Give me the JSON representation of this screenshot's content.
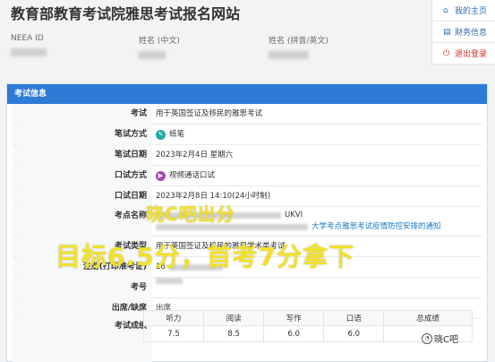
{
  "site_title": "教育部教育考试院雅思考试报名网站",
  "nav": {
    "my_homepage": "我的主页",
    "finance_info": "财务信息",
    "logout": "退出登录"
  },
  "info_row": {
    "neea_label": "NEEA ID",
    "name_cn_label": "姓名 (中文)",
    "name_en_label": "姓名 (拼音/英文)"
  },
  "panel": {
    "title": "考试信息",
    "rows": [
      {
        "label": "考试",
        "value": "用于英国签证及移民的雅思考试"
      },
      {
        "label": "笔试方式",
        "value": "纸笔"
      },
      {
        "label": "笔试日期",
        "value": "2023年2月4日 星期六"
      },
      {
        "label": "口试方式",
        "value": "视频通话口试"
      },
      {
        "label": "口试日期",
        "value": "2023年2月8日 14:10(24小时制)"
      },
      {
        "label": "考点名称",
        "value_line1": "UKVI",
        "value_line2": "大学考点雅思考试疫情防控安排的通知"
      },
      {
        "label": "考试类型",
        "value": "用于英国签证及移民的雅思学术类考试"
      },
      {
        "label": "注册(打印准考证)",
        "value": "16"
      },
      {
        "label": "考号",
        "value": ""
      },
      {
        "label": "出席/缺席",
        "value": "出席"
      },
      {
        "label": "考试成绩",
        "value": ""
      }
    ]
  },
  "scores": {
    "headers": [
      "听力",
      "阅读",
      "写作",
      "口语",
      "总成绩"
    ],
    "values": [
      "7.5",
      "8.5",
      "6.0",
      "6.0",
      ""
    ]
  },
  "overlay": {
    "line1": "晓C吧出分",
    "line2": "目标6.5分，首考7分拿下"
  },
  "watermark": "晓C吧"
}
